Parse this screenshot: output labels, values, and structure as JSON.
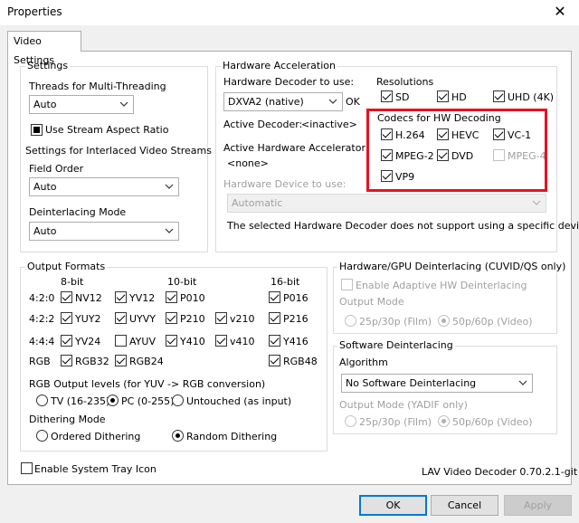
{
  "window": {
    "title": "Properties",
    "close_glyph": "✕"
  },
  "tab": {
    "label": "Video Settings"
  },
  "settings": {
    "legend": "Settings",
    "threads_label": "Threads for Multi-Threading",
    "threads_value": "Auto",
    "stream_aspect_label": "Use Stream Aspect Ratio",
    "interlaced_label": "Settings for Interlaced Video Streams",
    "field_order_label": "Field Order",
    "field_order_value": "Auto",
    "deinterlacing_mode_label": "Deinterlacing Mode",
    "deinterlacing_mode_value": "Auto"
  },
  "hwaccel": {
    "legend": "Hardware Acceleration",
    "decoder_label": "Hardware Decoder to use:",
    "decoder_value": "DXVA2 (native)",
    "ok_label": "OK",
    "active_decoder_label": "Active Decoder:",
    "active_decoder_value": "<inactive>",
    "active_accel_label": "Active Hardware Accelerator:",
    "active_accel_value": "<none>",
    "device_label": "Hardware Device to use:",
    "device_value": "Automatic",
    "note": "The selected Hardware Decoder does not support using a specific device.",
    "resolutions_label": "Resolutions",
    "resolutions": [
      "SD",
      "HD",
      "UHD (4K)"
    ],
    "codecs_label": "Codecs for HW Decoding",
    "codecs": [
      "H.264",
      "HEVC",
      "VC-1",
      "MPEG-2",
      "DVD",
      "MPEG-4",
      "VP9"
    ]
  },
  "output_formats": {
    "legend": "Output Formats",
    "col_headers": [
      "8-bit",
      "10-bit",
      "16-bit"
    ],
    "row_labels": [
      "4:2:0",
      "4:2:2",
      "4:4:4",
      "RGB"
    ],
    "formats": {
      "nv12": "NV12",
      "yv12": "YV12",
      "p010": "P010",
      "p016": "P016",
      "yuy2": "YUY2",
      "uyvy": "UYVY",
      "p210": "P210",
      "v210": "v210",
      "p216": "P216",
      "yv24": "YV24",
      "ayuv": "AYUV",
      "y410": "Y410",
      "v410": "v410",
      "y416": "Y416",
      "rgb32": "RGB32",
      "rgb24": "RGB24",
      "rgb48": "RGB48"
    },
    "rgb_levels_label": "RGB Output levels (for YUV -> RGB conversion)",
    "rgb_levels": [
      "TV (16-235)",
      "PC (0-255)",
      "Untouched (as input)"
    ],
    "dithering_label": "Dithering Mode",
    "dithering": [
      "Ordered Dithering",
      "Random Dithering"
    ]
  },
  "hw_deint": {
    "legend": "Hardware/GPU Deinterlacing (CUVID/QS only)",
    "adaptive_label": "Enable Adaptive HW Deinterlacing",
    "output_mode_label": "Output Mode",
    "modes": [
      "25p/30p (Film)",
      "50p/60p (Video)"
    ]
  },
  "sw_deint": {
    "legend": "Software Deinterlacing",
    "algorithm_label": "Algorithm",
    "algorithm_value": "No Software Deinterlacing",
    "output_mode_label": "Output Mode (YADIF only)",
    "modes": [
      "25p/30p (Film)",
      "50p/60p (Video)"
    ]
  },
  "footer": {
    "tray_label": "Enable System Tray Icon",
    "version": "LAV Video Decoder 0.70.2.1-git"
  },
  "buttons": {
    "ok": "OK",
    "cancel": "Cancel",
    "apply": "Apply"
  }
}
